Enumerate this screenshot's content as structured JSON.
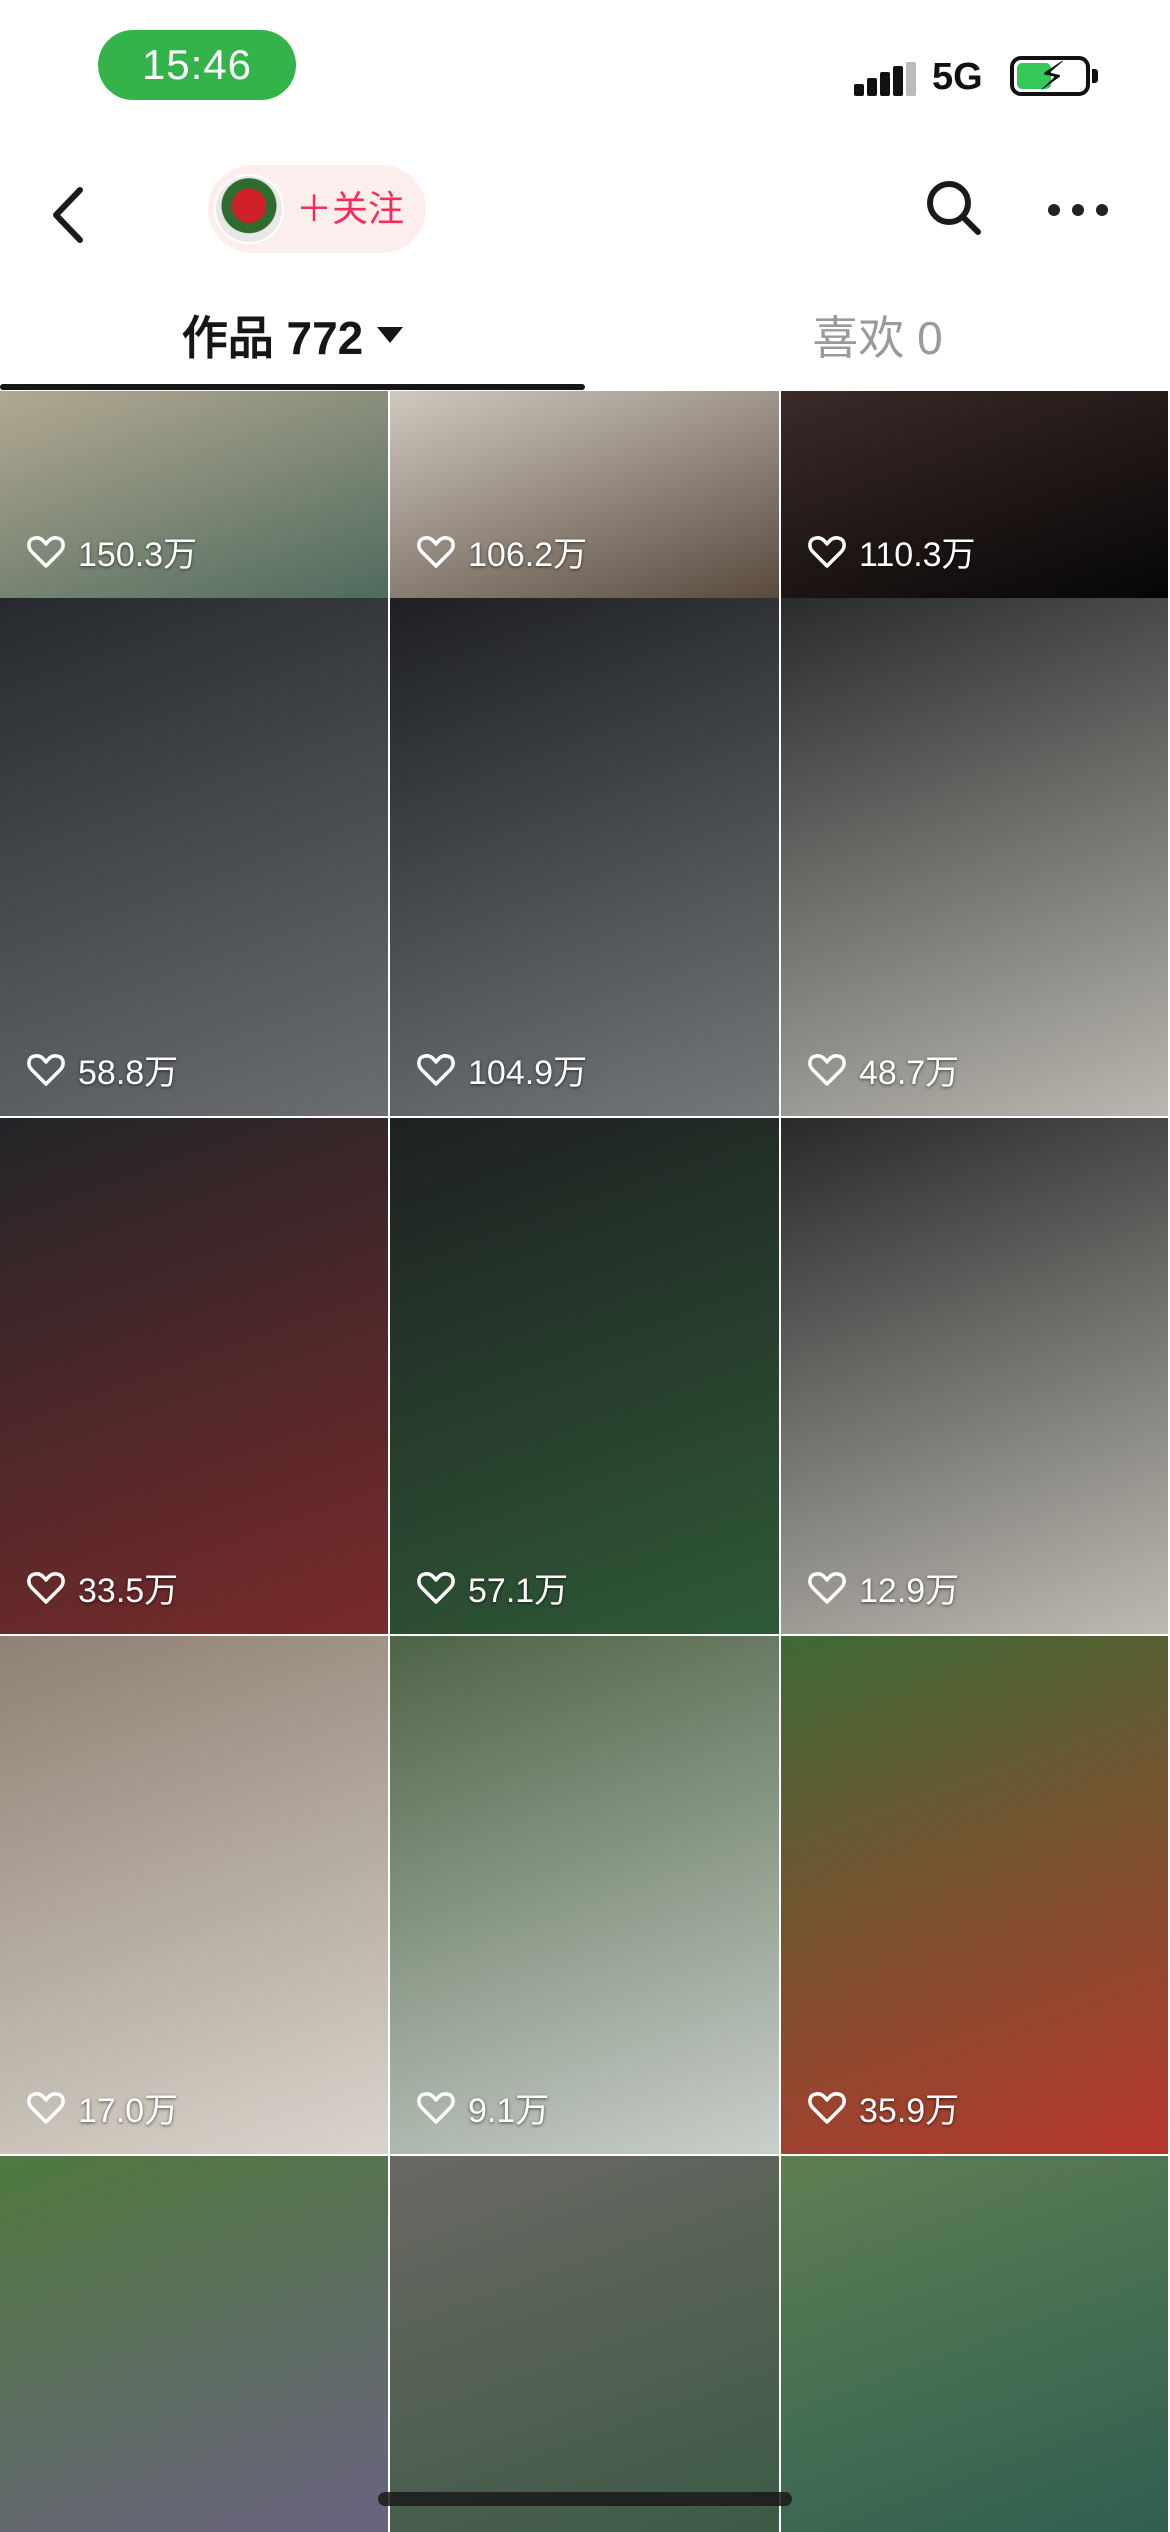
{
  "status_bar": {
    "time": "15:46",
    "network": "5G"
  },
  "nav": {
    "follow_label": "＋关注",
    "icons": [
      "back-arrow-icon",
      "search-icon",
      "more-icon"
    ]
  },
  "tabs": {
    "works_label": "作品 772",
    "likes_label": "喜欢 0"
  },
  "grid": [
    {
      "likes": "150.3万",
      "bg": [
        "#b2a892",
        "#4f6b5c"
      ]
    },
    {
      "likes": "106.2万",
      "bg": [
        "#cfc9c0",
        "#5a4a3e"
      ]
    },
    {
      "likes": "110.3万",
      "bg": [
        "#3b2a28",
        "#060606"
      ]
    },
    {
      "likes": "58.8万",
      "bg": [
        "#26292d",
        "#6a6e72"
      ]
    },
    {
      "likes": "104.9万",
      "bg": [
        "#1d1f22",
        "#74787a"
      ]
    },
    {
      "likes": "48.7万",
      "bg": [
        "#2a2b2d",
        "#b9b7ae"
      ]
    },
    {
      "likes": "33.5万",
      "bg": [
        "#232528",
        "#7a2a2a"
      ]
    },
    {
      "likes": "57.1万",
      "bg": [
        "#1e2022",
        "#2f5a36"
      ]
    },
    {
      "likes": "12.9万",
      "bg": [
        "#27292b",
        "#bdbab0"
      ]
    },
    {
      "likes": "17.0万",
      "bg": [
        "#8f8173",
        "#d9d4cc"
      ]
    },
    {
      "likes": "9.1万",
      "bg": [
        "#4e6446",
        "#c9cfca"
      ]
    },
    {
      "likes": "35.9万",
      "bg": [
        "#3d6a34",
        "#b8372c"
      ]
    },
    {
      "likes": "",
      "bg": [
        "#4f7a3e",
        "#6a6380"
      ]
    },
    {
      "likes": "",
      "bg": [
        "#6a6862",
        "#3c5a46"
      ]
    },
    {
      "likes": "",
      "bg": [
        "#5e7f52",
        "#2f5e50"
      ]
    }
  ],
  "colors": {
    "accent": "#f0305a",
    "status_green": "#34b34a"
  }
}
